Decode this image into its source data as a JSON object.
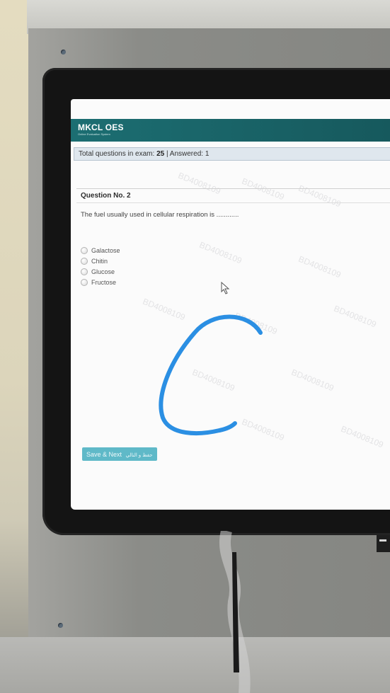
{
  "app": {
    "title": "MKCL OES",
    "subtitle": "Online Evaluation System"
  },
  "status": {
    "total_label": "Total questions in exam:",
    "total_value": "25",
    "answered_label": "| Answered: 1"
  },
  "question": {
    "heading": "Question No. 2",
    "text": "The fuel usually used in cellular respiration is ............",
    "options": [
      "Galactose",
      "Chitin",
      "Glucose",
      "Fructose"
    ]
  },
  "actions": {
    "save_next_label": "Save & Next",
    "save_next_label_alt": "حفظ و التالي"
  },
  "watermark_text": "BD4008109",
  "colors": {
    "header": "#1c6e72",
    "button": "#5fb9c8",
    "ink": "#2b8fe3"
  }
}
